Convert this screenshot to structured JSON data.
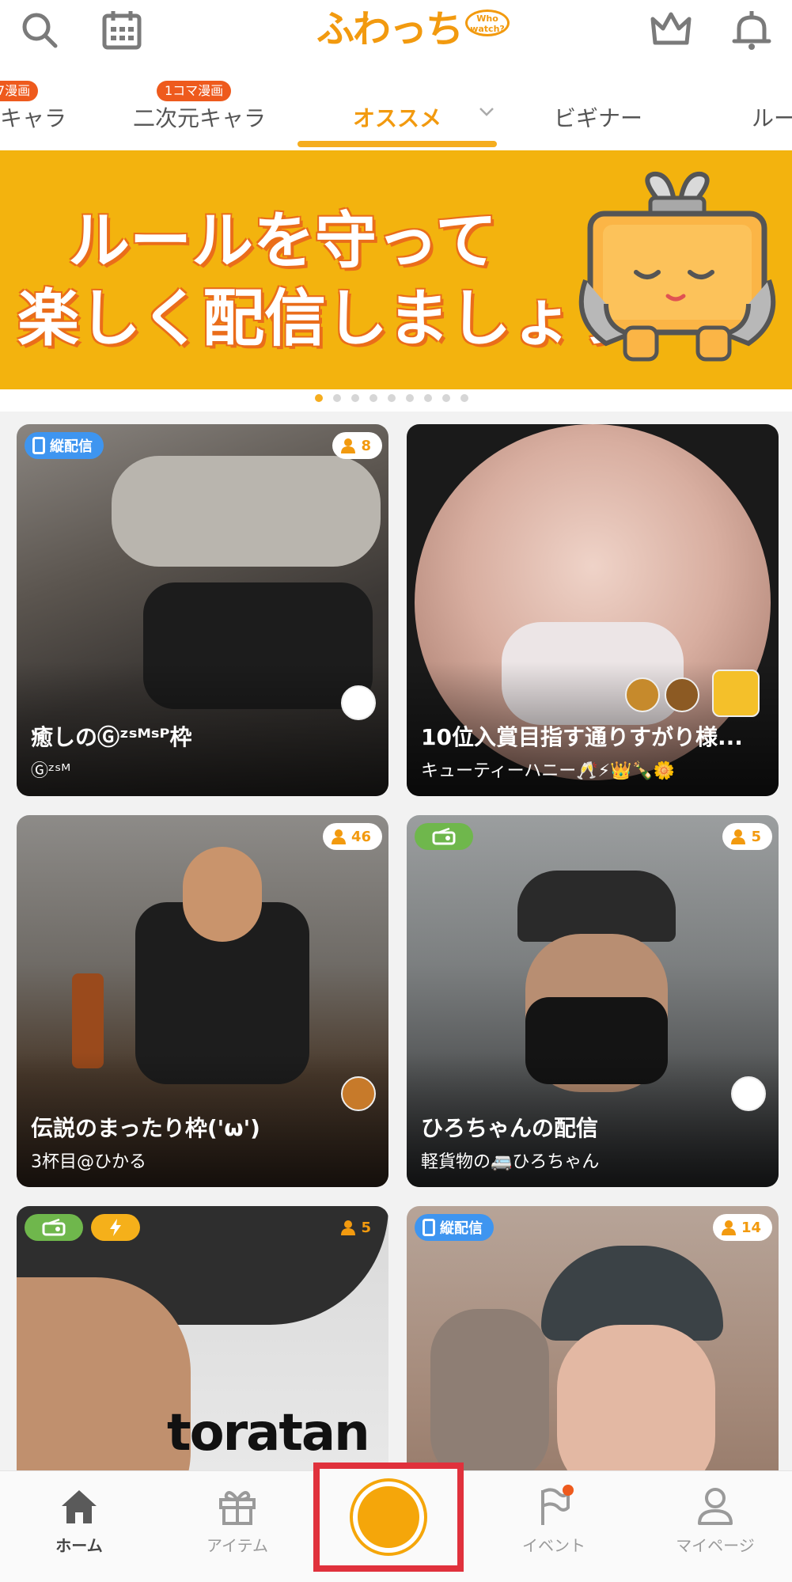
{
  "header": {
    "logo_text": "ふわっち",
    "logo_bubble": "Who watch?",
    "icons": [
      "search-icon",
      "calendar-icon",
      "crown-icon",
      "bell-icon"
    ]
  },
  "tabs": [
    {
      "label": "キャラ",
      "badge": "7漫画"
    },
    {
      "label": "二次元キャラ",
      "badge": "1コマ漫画"
    },
    {
      "label": "オススメ",
      "badge": "",
      "active": true
    },
    {
      "label": "ビギナー",
      "badge": ""
    },
    {
      "label": "ルー",
      "badge": ""
    }
  ],
  "banner": {
    "line1": "ルールを守って",
    "line2": "楽しく配信しましょう",
    "page_count": 9,
    "active_index": 0
  },
  "cards": [
    {
      "title": "癒しのⒼᶻˢᴹˢᴾ枠",
      "subtitle": "Ⓖᶻˢᴹ",
      "viewers": "8",
      "tag": "縦配信"
    },
    {
      "title": "10位入賞目指す通りすがり様...",
      "subtitle": "キューティーハニー🥂⚡👑🍾🌼",
      "viewers": "",
      "tag": ""
    },
    {
      "title": "伝説のまったり枠('ω')",
      "subtitle": "3杯目@ひかる",
      "viewers": "46",
      "tag": ""
    },
    {
      "title": "ひろちゃんの配信",
      "subtitle": "軽貨物の🚐ひろちゃん",
      "viewers": "5",
      "tag": "radio"
    },
    {
      "title": "toratan",
      "subtitle": "",
      "viewers": "5",
      "tag": "radio"
    },
    {
      "title": "",
      "subtitle": "",
      "viewers": "14",
      "tag": "縦配信"
    }
  ],
  "nav": {
    "home": "ホーム",
    "items": "アイテム",
    "events": "イベント",
    "mypage": "マイページ"
  },
  "colors": {
    "accent": "#f29a0f",
    "banner": "#f3b30e",
    "tag_blue": "#3e95f0",
    "radio_green": "#6fb74c",
    "highlight_red": "#e0313c"
  }
}
